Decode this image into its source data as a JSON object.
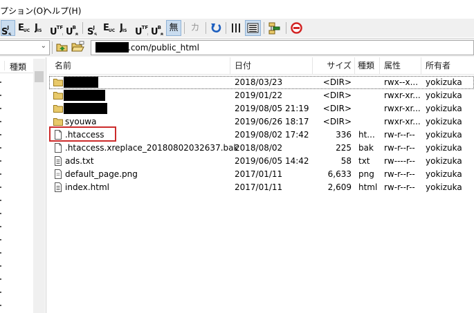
{
  "menubar": {
    "items": [
      "プション(O)",
      "ヘルプ(H)"
    ]
  },
  "toolbar": {
    "buttons": [
      {
        "letter": "S",
        "sup": "J",
        "sub": "S",
        "name": "sjis-button",
        "active": true
      },
      {
        "letter": "E",
        "sup": "",
        "sub": "UC",
        "name": "euc-button"
      },
      {
        "letter": "J",
        "sup": "",
        "sub": "IS",
        "name": "jis-button"
      },
      {
        "letter": "U",
        "sup": "TF",
        "sub": "8",
        "name": "utf8-button"
      },
      {
        "letter": "U",
        "sup": "B",
        "sub": "8",
        "name": "utf8-bom-button"
      },
      {
        "letter": "S",
        "sup": "J",
        "sub": "S",
        "name": "sjis-button-2"
      },
      {
        "letter": "E",
        "sup": "",
        "sub": "UC",
        "name": "euc-button-2"
      },
      {
        "letter": "J",
        "sup": "",
        "sub": "IS",
        "name": "jis-button-2"
      },
      {
        "letter": "U",
        "sup": "TF",
        "sub": "8",
        "name": "utf8-button-2"
      },
      {
        "letter": "U",
        "sup": "B",
        "sub": "8",
        "name": "utf8-bom-button-2"
      },
      {
        "letter": "無",
        "sup": "",
        "sub": "",
        "name": "no-conversion-button",
        "active": true
      },
      {
        "letter": "カ",
        "sup": "",
        "sub": "",
        "name": "kana-button",
        "disabled": true
      }
    ]
  },
  "addressbar": {
    "path": ".com/public_html"
  },
  "left_pane": {
    "header_label": "種類"
  },
  "file_list": {
    "columns": [
      "名前",
      "日付",
      "サイズ",
      "種類",
      "属性",
      "所有者"
    ],
    "rows": [
      {
        "name": "",
        "redacted": true,
        "date": "2018/03/23",
        "size": "<DIR>",
        "type": "",
        "attr": "rwx--x...",
        "owner": "yokizuka",
        "icon": "folder-icon"
      },
      {
        "name": "",
        "redacted": true,
        "date": "2019/01/22",
        "size": "<DIR>",
        "type": "",
        "attr": "rwxr-xr...",
        "owner": "yokizuka",
        "icon": "folder-icon"
      },
      {
        "name": "",
        "redacted": true,
        "date": "2019/08/05 21:19",
        "size": "<DIR>",
        "type": "",
        "attr": "rwxr-xr...",
        "owner": "yokizuka",
        "icon": "folder-icon"
      },
      {
        "name": "syouwa",
        "date": "2019/06/26 18:17",
        "size": "<DIR>",
        "type": "",
        "attr": "rwxr-xr...",
        "owner": "yokizuka",
        "icon": "folder-icon"
      },
      {
        "name": ".htaccess",
        "date": "2019/08/02 17:42",
        "size": "336",
        "type": "ht...",
        "attr": "rw-r--r--",
        "owner": "yokizuka",
        "icon": "file-icon"
      },
      {
        "name": ".htaccess.xreplace_20180802032637.bak",
        "date": "2018/08/02",
        "size": "225",
        "type": "bak",
        "attr": "rw-r--r--",
        "owner": "yokizuka",
        "icon": "file-icon"
      },
      {
        "name": "ads.txt",
        "date": "2019/06/05 14:42",
        "size": "58",
        "type": "txt",
        "attr": "rw----r--",
        "owner": "yokizuka",
        "icon": "text-file-icon"
      },
      {
        "name": "default_page.png",
        "date": "2017/01/11",
        "size": "6,633",
        "type": "png",
        "attr": "rw-r--r--",
        "owner": "yokizuka",
        "icon": "image-file-icon"
      },
      {
        "name": "index.html",
        "date": "2017/01/11",
        "size": "2,609",
        "type": "html",
        "attr": "rw-r--r--",
        "owner": "yokizuka",
        "icon": "text-file-icon"
      }
    ]
  },
  "colors": {
    "highlight_box": "#cc2a2a",
    "active_button_bg": "#c9dcef",
    "folder": "#e8c96a",
    "refresh_blue": "#1e5fbf",
    "stop_red": "#d22222"
  }
}
